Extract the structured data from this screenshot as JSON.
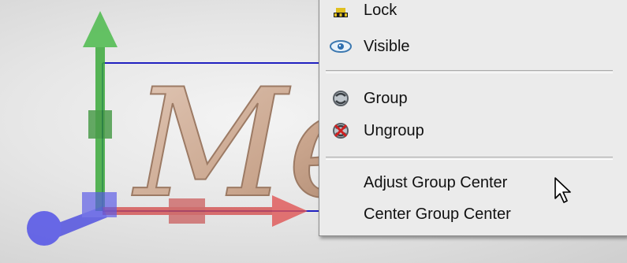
{
  "menu": {
    "items": [
      {
        "label": "Lock",
        "icon": "lock-icon"
      },
      {
        "label": "Visible",
        "icon": "eye-icon"
      },
      {
        "label": "Group",
        "icon": "group-icon"
      },
      {
        "label": "Ungroup",
        "icon": "ungroup-icon"
      },
      {
        "label": "Adjust Group Center",
        "icon": ""
      },
      {
        "label": "Center Group Center",
        "icon": ""
      }
    ]
  },
  "scene": {
    "text_fragment": "Me",
    "axis_colors": {
      "y": "#3caa3c",
      "x": "#e05050",
      "z": "#4a4ae0"
    },
    "bounding_box_color": "#2020c0"
  },
  "cursor": {
    "icon": "arrow-cursor-icon"
  }
}
